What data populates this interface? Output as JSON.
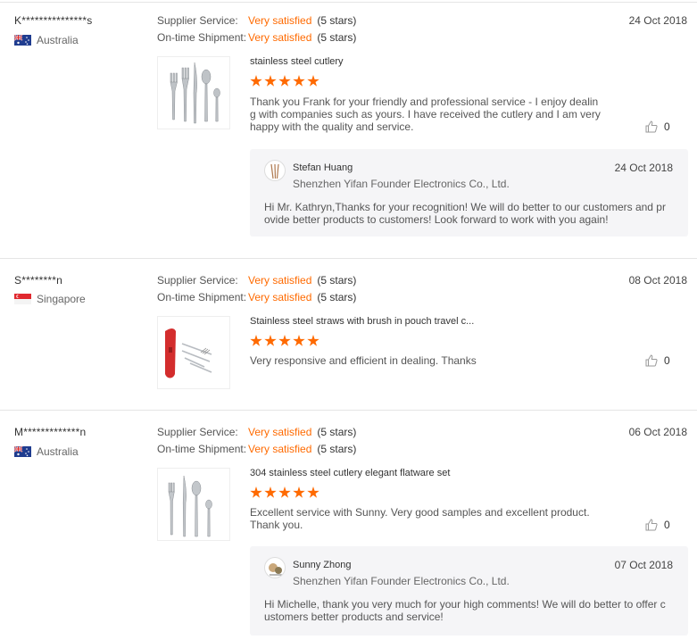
{
  "reviews": [
    {
      "buyer": "K***************s",
      "country": "Australia",
      "supplier_label": "Supplier Service:",
      "supplier_value": "Very satisfied",
      "supplier_stars": "(5 stars)",
      "shipment_label": "On-time Shipment:",
      "shipment_value": "Very satisfied",
      "shipment_stars": "(5 stars)",
      "date": "24 Oct 2018",
      "product_title": "stainless steel cutlery",
      "product_rating": 5,
      "comment": "Thank you Frank for your friendly and professional service - I enjoy dealin g with companies such as yours. I have received the cutlery and I am very happy with the quality and service.",
      "likes": "0",
      "reply": {
        "name": "Stefan Huang",
        "company": "Shenzhen Yifan Founder Electronics Co., Ltd.",
        "date": "24 Oct 2018",
        "text": "Hi Mr. Kathryn,Thanks for your recognition! We will do better to our customers and pr ovide better products to customers! Look forward to work with you again!"
      }
    },
    {
      "buyer": "S********n",
      "country": "Singapore",
      "supplier_label": "Supplier Service:",
      "supplier_value": "Very satisfied",
      "supplier_stars": "(5 stars)",
      "shipment_label": "On-time Shipment:",
      "shipment_value": "Very satisfied",
      "shipment_stars": "(5 stars)",
      "date": "08 Oct 2018",
      "product_title": "Stainless steel straws with brush in pouch travel c...",
      "product_rating": 5,
      "comment": "Very responsive and efficient in dealing.  Thanks",
      "likes": "0"
    },
    {
      "buyer": "M*************n",
      "country": "Australia",
      "supplier_label": "Supplier Service:",
      "supplier_value": "Very satisfied",
      "supplier_stars": "(5 stars)",
      "shipment_label": "On-time Shipment:",
      "shipment_value": "Very satisfied",
      "shipment_stars": "(5 stars)",
      "date": "06 Oct 2018",
      "product_title": "304 stainless steel cutlery elegant flatware set",
      "product_rating": 5,
      "comment": "Excellent service with Sunny.  Very good samples and excellent product. Thank you.",
      "likes": "0",
      "reply": {
        "name": "Sunny Zhong",
        "company": "Shenzhen Yifan Founder Electronics Co., Ltd.",
        "date": "07 Oct 2018",
        "text": "Hi Michelle, thank you very much for your high comments! We will do better to offer c ustomers better products and service!"
      }
    }
  ],
  "colors": {
    "accent": "#ff6a00",
    "reply_bg": "#f5f5f7",
    "divider": "#e5e5e5"
  },
  "icons": {
    "like": "thumbs-up-icon",
    "flag_au": "australia-flag-icon",
    "flag_sg": "singapore-flag-icon"
  }
}
